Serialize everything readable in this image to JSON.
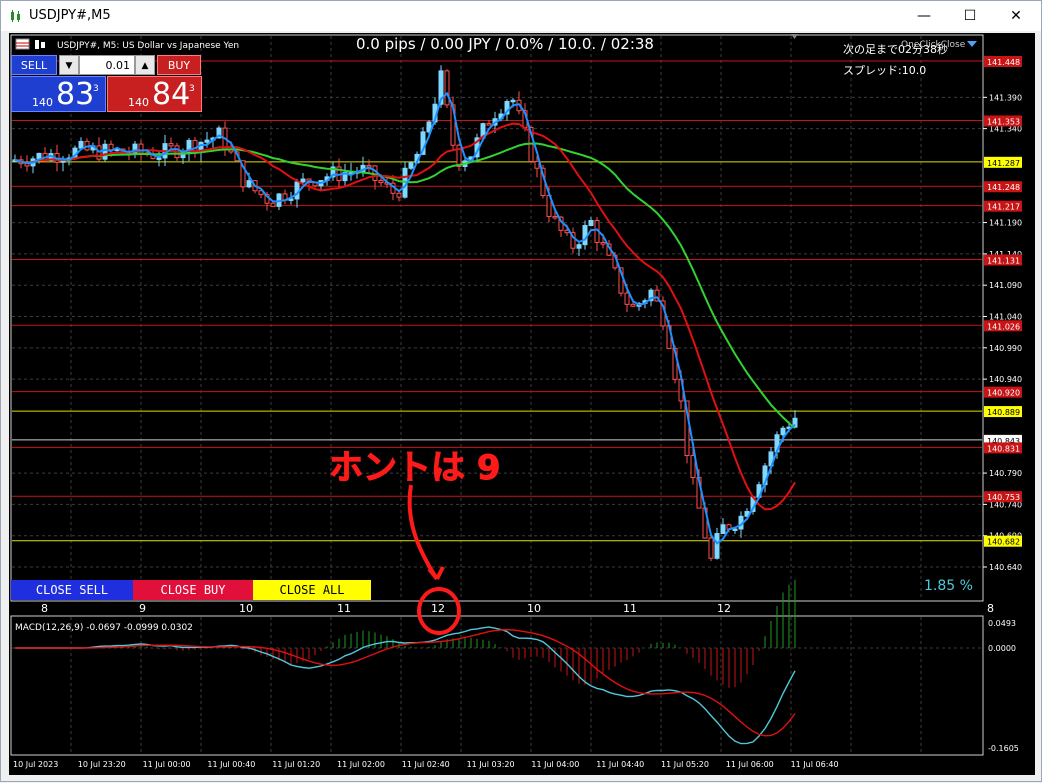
{
  "window": {
    "title": "USDJPY#,M5",
    "controls": {
      "minimize": "—",
      "maximize": "☐",
      "close": "✕"
    }
  },
  "chart": {
    "symbol_label": "USDJPY#, M5:  US Dollar vs Japanese Yen",
    "header_info": "0.0 pips / 0.00 JPY / 0.0% / 10.0. / 02:38",
    "next_bar": "次の足まで02分38秒",
    "spread": "スプレッド:10.0",
    "close_all_label": "OneClickClose",
    "percent": "1.85 %",
    "annotation": "ホントは 9"
  },
  "trade_panel": {
    "sell_label": "SELL",
    "buy_label": "BUY",
    "lot": "0.01",
    "lot_down": "▼",
    "lot_up": "▲",
    "sell_prefix": "140",
    "sell_big": "83",
    "sell_sup": "3",
    "buy_prefix": "140",
    "buy_big": "84",
    "buy_sup": "3"
  },
  "close_buttons": {
    "close_sell": "CLOSE SELL",
    "close_buy": "CLOSE BUY",
    "close_all": "CLOSE ALL"
  },
  "price_axis": [
    "141.390",
    "141.340",
    "141.190",
    "141.140",
    "141.090",
    "141.040",
    "140.990",
    "140.940",
    "140.790",
    "140.740",
    "140.690",
    "140.640"
  ],
  "price_tags": [
    {
      "label": "141.448",
      "bg": "#c81414",
      "fg": "#ffffff"
    },
    {
      "label": "141.353",
      "bg": "#c81414",
      "fg": "#ffffff"
    },
    {
      "label": "141.287",
      "bg": "#ffff00",
      "fg": "#000000"
    },
    {
      "label": "141.248",
      "bg": "#c81414",
      "fg": "#ffffff"
    },
    {
      "label": "141.217",
      "bg": "#c81414",
      "fg": "#ffffff"
    },
    {
      "label": "141.131",
      "bg": "#c81414",
      "fg": "#ffffff"
    },
    {
      "label": "141.026",
      "bg": "#c81414",
      "fg": "#ffffff"
    },
    {
      "label": "140.920",
      "bg": "#c81414",
      "fg": "#ffffff"
    },
    {
      "label": "140.889",
      "bg": "#ffff00",
      "fg": "#000000"
    },
    {
      "label": "140.843",
      "bg": "#ffffff",
      "fg": "#000000"
    },
    {
      "label": "140.831",
      "bg": "#c81414",
      "fg": "#ffffff"
    },
    {
      "label": "140.753",
      "bg": "#c81414",
      "fg": "#ffffff"
    },
    {
      "label": "140.682",
      "bg": "#ffff00",
      "fg": "#000000"
    }
  ],
  "day_scale": [
    "8",
    "9",
    "10",
    "11",
    "12",
    "10",
    "11",
    "12",
    "8"
  ],
  "macd": {
    "label": "MACD(12,26,9) -0.0697 -0.0999 0.0302",
    "axis": [
      "0.0493",
      "0.0000",
      "-0.1605"
    ]
  },
  "time_axis": [
    "10 Jul 2023",
    "10 Jul 23:20",
    "11 Jul 00:00",
    "11 Jul 00:40",
    "11 Jul 01:20",
    "11 Jul 02:00",
    "11 Jul 02:40",
    "11 Jul 03:20",
    "11 Jul 04:00",
    "11 Jul 04:40",
    "11 Jul 05:20",
    "11 Jul 06:00",
    "11 Jul 06:40"
  ],
  "colors": {
    "bull_candle": "#7fd8ff",
    "bear_candle": "#ff5050",
    "ma_fast": "#1e90ff",
    "ma_mid": "#e01010",
    "ma_slow": "#32d232",
    "annotation": "#ff1a1a"
  }
}
